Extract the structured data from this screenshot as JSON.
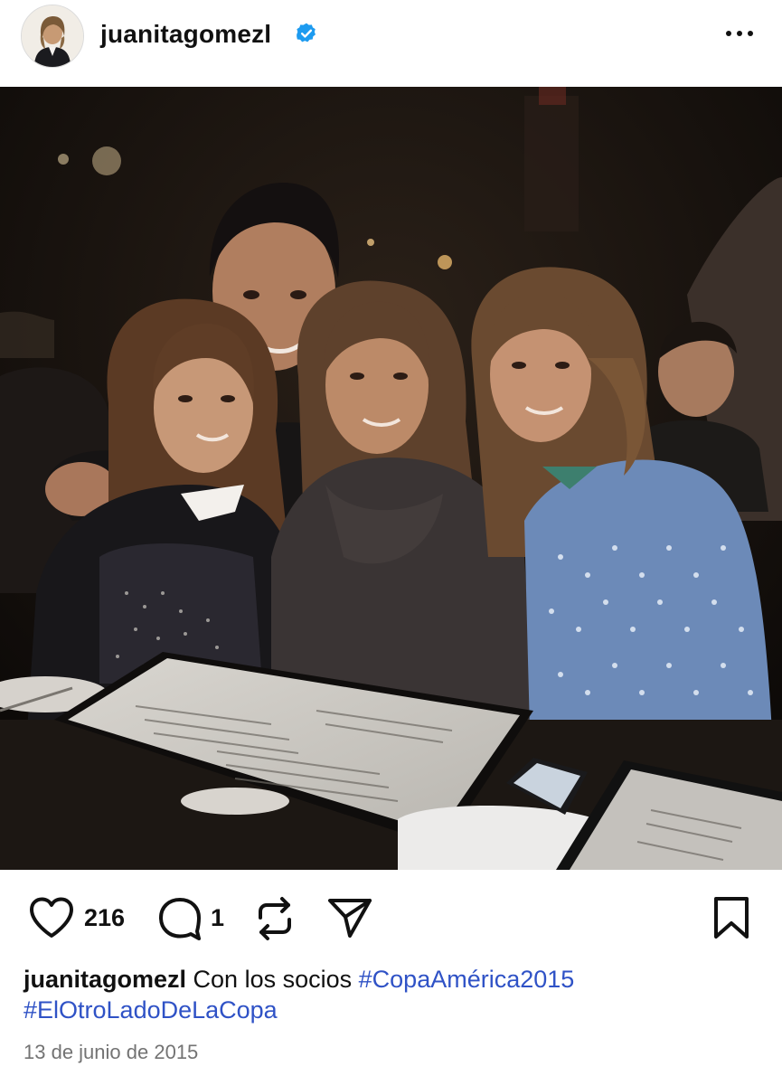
{
  "header": {
    "username": "juanitagomezl",
    "verified_icon": "verified-badge-icon",
    "more_icon": "more-options-icon"
  },
  "post": {
    "photo_description_icon": "group-photo"
  },
  "actions": {
    "like_icon": "heart-icon",
    "like_count": "216",
    "comment_icon": "comment-icon",
    "comment_count": "1",
    "repost_icon": "repost-icon",
    "share_icon": "send-icon",
    "save_icon": "bookmark-icon"
  },
  "caption": {
    "username": "juanitagomezl",
    "text": "Con los socios",
    "hashtags": [
      "#CopaAmérica2015",
      "#ElOtroLadoDeLaCopa"
    ]
  },
  "date": "13 de junio de 2015",
  "colors": {
    "hashtag": "#2f52c6",
    "verified": "#1d9bf0",
    "date": "#737373"
  }
}
